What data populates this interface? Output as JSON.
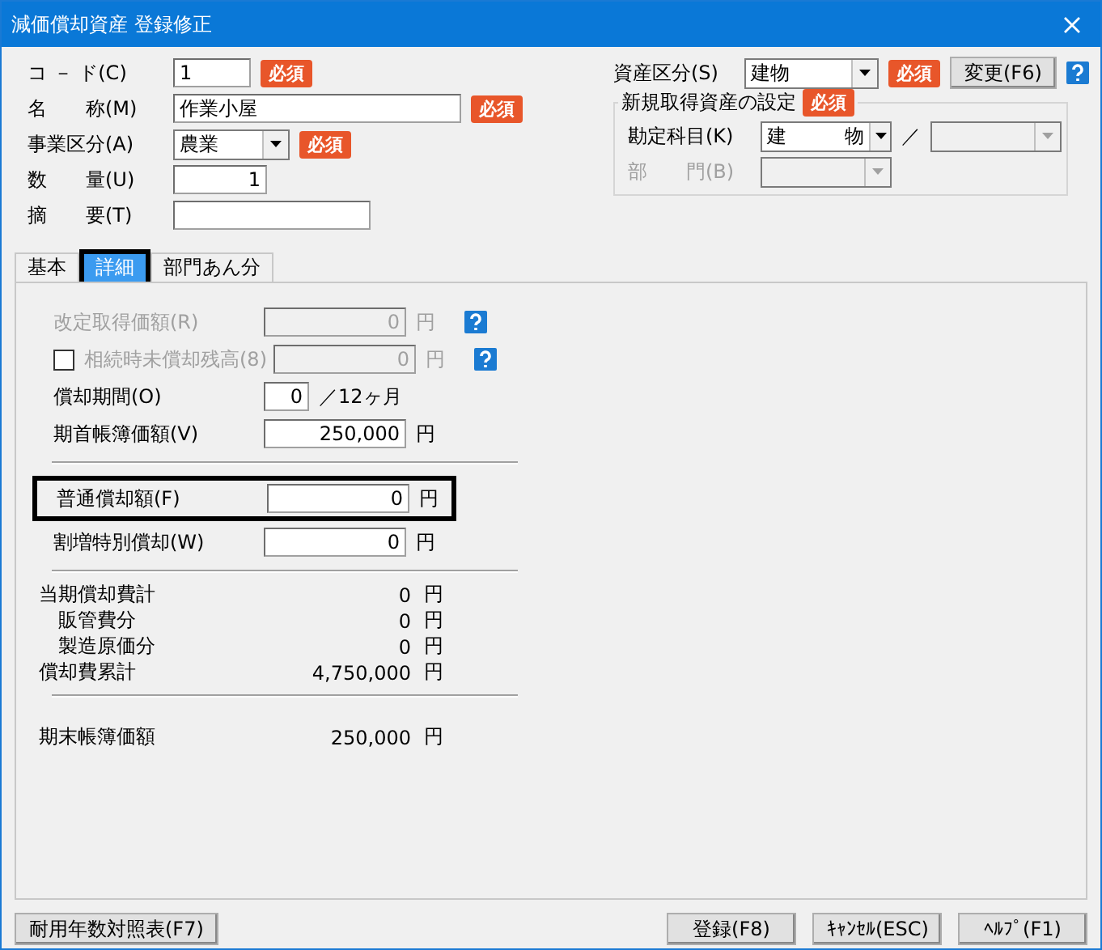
{
  "window": {
    "title": "減価償却資産 登録修正"
  },
  "fields": [
    {
      "label": "コ － ド(C)",
      "kind": "input",
      "value": "1",
      "required": true,
      "required_label": "必須"
    },
    {
      "label": "名　　称(M)",
      "kind": "input",
      "value": "作業小屋",
      "required": true,
      "required_label": "必須"
    },
    {
      "label": "事業区分(A)",
      "kind": "select",
      "value": "農業",
      "required": true,
      "required_label": "必須"
    },
    {
      "label": "数　　量(U)",
      "kind": "input",
      "value": "1",
      "required": false
    },
    {
      "label": "摘　　要(T)",
      "kind": "input",
      "required": false
    }
  ],
  "asset_class": {
    "label": "資産区分(S)",
    "value": "建物",
    "required_label": "必須",
    "button": "変更(F6)"
  },
  "new_asset_group": {
    "title": "新規取得資産の設定",
    "required_label": "必須",
    "account": {
      "label": "勘定科目(K)",
      "value": "建　　　物",
      "separator": "／"
    },
    "department": {
      "label": "部　　門(B)",
      "disabled": true
    }
  },
  "tabs": [
    {
      "label": "基本",
      "selected": false,
      "highlighted": false
    },
    {
      "label": "詳細",
      "selected": true,
      "highlighted": true
    },
    {
      "label": "部門あん分",
      "selected": false,
      "highlighted": false
    }
  ],
  "detail_rows": [
    {
      "kind": "input",
      "label": "改定取得価額(R)",
      "value": "0",
      "unit": "円",
      "disabled": true,
      "help": true,
      "highlighted": false
    },
    {
      "kind": "check-input",
      "label": "相続時未償却残高(8)",
      "value": "0",
      "unit": "円",
      "disabled": true,
      "help": true,
      "checked": false,
      "highlighted": false
    },
    {
      "kind": "period",
      "label": "償却期間(O)",
      "value": "0",
      "suffix": "／12ヶ月"
    },
    {
      "kind": "input",
      "label": "期首帳簿価額(V)",
      "value": "250,000",
      "unit": "円",
      "disabled": false,
      "help": false,
      "highlighted": false
    },
    {
      "kind": "separator"
    },
    {
      "kind": "input",
      "label": "普通償却額(F)",
      "value": "0",
      "unit": "円",
      "disabled": false,
      "help": false,
      "highlighted": true
    },
    {
      "kind": "input",
      "label": "割増特別償却(W)",
      "value": "0",
      "unit": "円",
      "disabled": false,
      "help": false,
      "highlighted": false
    },
    {
      "kind": "separator"
    },
    {
      "kind": "total",
      "label": "当期償却費計",
      "value": "0",
      "unit": "円",
      "indent": false
    },
    {
      "kind": "total",
      "label": "販管費分",
      "value": "0",
      "unit": "円",
      "indent": true
    },
    {
      "kind": "total",
      "label": "製造原価分",
      "value": "0",
      "unit": "円",
      "indent": true
    },
    {
      "kind": "total",
      "label": "償却費累計",
      "value": "4,750,000",
      "unit": "円",
      "indent": false
    },
    {
      "kind": "separator"
    },
    {
      "kind": "gap"
    },
    {
      "kind": "total",
      "label": "期末帳簿価額",
      "value": "250,000",
      "unit": "円",
      "indent": false
    }
  ],
  "footer": {
    "left_button": "耐用年数対照表(F7)",
    "buttons": [
      "登録(F8)",
      "ｷｬﾝｾﾙ(ESC)",
      "ﾍﾙﾌﾟ(F1)"
    ]
  }
}
